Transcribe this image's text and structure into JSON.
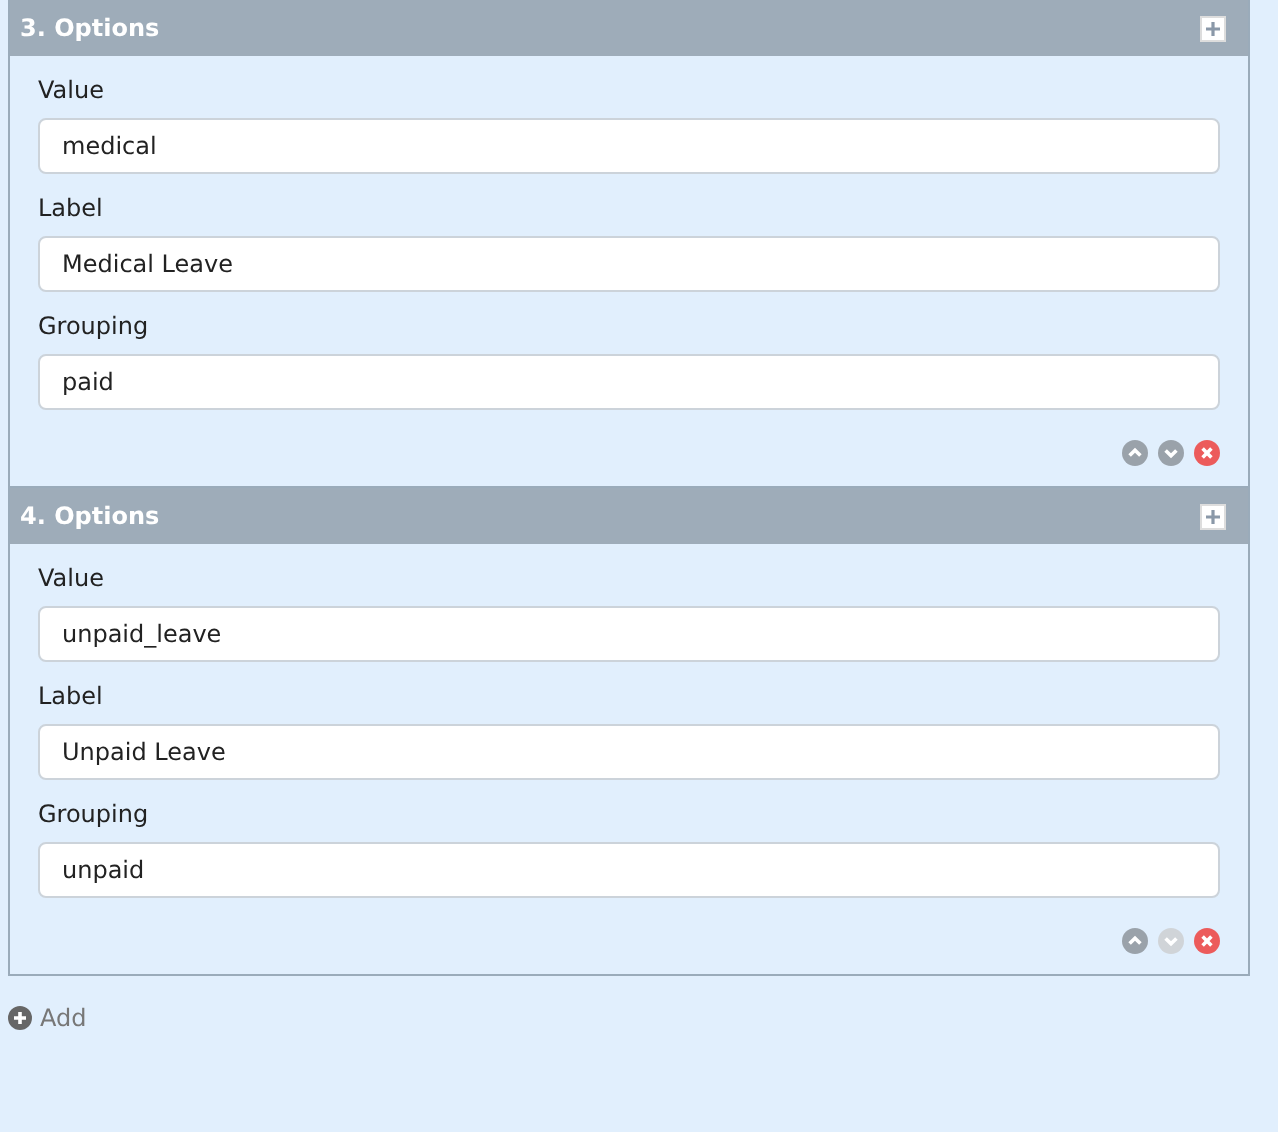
{
  "panels": [
    {
      "title": "3. Options",
      "fields": [
        {
          "label": "Value",
          "value": "medical"
        },
        {
          "label": "Label",
          "value": "Medical Leave"
        },
        {
          "label": "Grouping",
          "value": "paid"
        }
      ],
      "move_up_disabled": false,
      "move_down_disabled": false
    },
    {
      "title": "4. Options",
      "fields": [
        {
          "label": "Value",
          "value": "unpaid_leave"
        },
        {
          "label": "Label",
          "value": "Unpaid Leave"
        },
        {
          "label": "Grouping",
          "value": "unpaid"
        }
      ],
      "move_up_disabled": false,
      "move_down_disabled": true
    }
  ],
  "add_link": "Add"
}
